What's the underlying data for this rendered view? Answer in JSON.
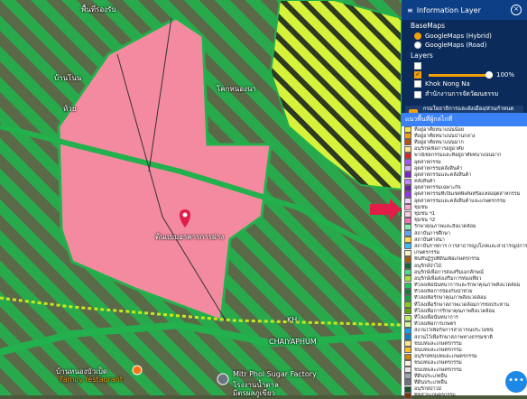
{
  "map": {
    "labels": {
      "aerial_top": "พื้นที่รองรับ",
      "place_1": "บ้านโนน",
      "place_2": "ห้วย",
      "place_3": "โคกหนองนา",
      "marker_label": "ต้นแบบอาคารการฝาง",
      "road_1": "KH",
      "road_2": "CHAIYAPHUM",
      "place_4": "บ้านหนองบัวเป็ด",
      "place_4_sub": "Family restaurant",
      "factory": "Mitr Phol Sugar Factory",
      "factory_sub": "โรงงานน้ำตาล",
      "factory_sub2": "มิตรผลภูเขียว"
    },
    "colors": {
      "zone_pink": "#f48aa0",
      "zone_green": "#22b14c",
      "zone_yellow": "#d7f23a",
      "marker": "#e11d48"
    }
  },
  "panel": {
    "title": "Information Layer",
    "close_icon": "close-icon",
    "basemaps_label": "BaseMaps",
    "basemaps": [
      {
        "label": "GoogleMaps (Hybrid)",
        "selected": true
      },
      {
        "label": "GoogleMaps (Road)",
        "selected": false
      }
    ],
    "layers_label": "Layers",
    "opacity_value": "100%",
    "layer_items": [
      "Khok Nong Na",
      "สำนักงานการจัดวัฒนธรรม"
    ],
    "banner_text": "กรมโยธาธิการและผังเมือง/ส่วนกำหนดพื้นที่",
    "legend_title": "แนวพื้นที่ผู้กลไกที่",
    "legend": [
      {
        "label": "ที่อยู่อาศัยหนาแน่นน้อย",
        "color": "#f5e74a"
      },
      {
        "label": "ที่อยู่อาศัยหนาแน่นปานกลาง",
        "color": "#f59e0b"
      },
      {
        "label": "ที่อยู่อาศัยหนาแน่นมาก",
        "color": "#b45309"
      },
      {
        "label": "อนุรักษ์เพื่อการอยู่อาศัย",
        "color": "#fde68a"
      },
      {
        "label": "พาณิชยกรรมและที่อยู่อาศัยหนาแน่นมาก",
        "color": "#dc2626"
      },
      {
        "label": "อุตสาหกรรม",
        "color": "#a855f7"
      },
      {
        "label": "อุตสาหกรรมคลังสินค้า",
        "color": "#d8b4fe"
      },
      {
        "label": "อุตสาหกรรมและคลังสินค้า",
        "color": "#7e22ce"
      },
      {
        "label": "คลังสินค้า",
        "color": "#c084fc"
      },
      {
        "label": "อุตสาหกรรมเฉพาะกิจ",
        "color": "#6b21a8"
      },
      {
        "label": "อุตสาหกรรมที่เป็นเขตพิเศษหรือแหล่งอุตสาหกรรม",
        "color": "#9333ea"
      },
      {
        "label": "อุตสาหกรรมและคลังสินค้าและเกษตรกรรม",
        "color": "#e9d5ff"
      },
      {
        "label": "ชุมชน",
        "color": "#f9a8d4"
      },
      {
        "label": "ชุมชน ฯ1",
        "color": "#fbcfe8"
      },
      {
        "label": "ชุมชน ฯ2",
        "color": "#f472b6"
      },
      {
        "label": "รักษาคุณภาพและสิ่งแวดล้อม",
        "color": "#86efac"
      },
      {
        "label": "สถาบันการศึกษา",
        "color": "#60a5fa"
      },
      {
        "label": "สถาบันศาสนา",
        "color": "#fde047"
      },
      {
        "label": "สถาบันราชการ การสาธารณูปโภคและสาธารณูปการ",
        "color": "#38bdf8"
      },
      {
        "label": "เกษตรกรรม",
        "color": "#fef3c7"
      },
      {
        "label": "พื้นที่ปฏิรูปที่ดินเพื่อเกษตรกรรม",
        "color": "#a16207"
      },
      {
        "label": "อนุรักษ์ป่าไม้",
        "color": "#166534"
      },
      {
        "label": "อนุรักษ์เพื่อการส่งเสริมเอกลักษณ์",
        "color": "#4ade80"
      },
      {
        "label": "อนุรักษ์เพื่อส่งเสริมการท่องเที่ยว",
        "color": "#a3e635"
      },
      {
        "label": "ที่โล่งเพื่อนันทนาการและรักษาคุณภาพสิ่งแวดล้อม",
        "color": "#22c55e"
      },
      {
        "label": "ที่โล่งเพื่อการป้องกันน้ำท่วม",
        "color": "#15803d"
      },
      {
        "label": "ที่โล่งเพื่อรักษาคุณภาพสิ่งแวดล้อม",
        "color": "#16a34a"
      },
      {
        "label": "ที่โล่งเพื่อรักษาสภาพแวดล้อมการชลประทาน",
        "color": "#84cc16"
      },
      {
        "label": "ที่โล่งเพื่อการรักษาคุณภาพสิ่งแวดล้อม",
        "color": "#65a30d"
      },
      {
        "label": "ที่โล่งเพื่อนันทนาการ",
        "color": "#bef264"
      },
      {
        "label": "ที่โล่งเพื่อการเกษตร",
        "color": "#d9f99d"
      },
      {
        "label": "สงวนไว้เพื่อกิจการสาธารณประโยชน์",
        "color": "#0ea5e9"
      },
      {
        "label": "สงวนไว้เพื่อรักษาสภาพทางธรรมชาติ",
        "color": "#0284c7"
      },
      {
        "label": "ชนบทและเกษตรกรรม",
        "color": "#fde68a"
      },
      {
        "label": "ชนบทและเกษตรกรรม",
        "color": "#fbbf24"
      },
      {
        "label": "อนุรักษ์ชนบทและเกษตรกรรม",
        "color": "#ca8a04"
      },
      {
        "label": "ชนบทและเกษตรกรรม",
        "color": "#f5f5dc"
      },
      {
        "label": "ชนบทและเกษตรกรรม",
        "color": "#e5e7eb"
      },
      {
        "label": "ที่ดินประเภทอื่น",
        "color": "#9ca3af"
      },
      {
        "label": "ที่ดินประเภทอื่น",
        "color": "#6b7280"
      },
      {
        "label": "อนุรักษ์ป่าไม้",
        "color": "#14532d"
      },
      {
        "label": "พืชสวนเกษตรกรรม",
        "color": "#78350f"
      }
    ]
  }
}
